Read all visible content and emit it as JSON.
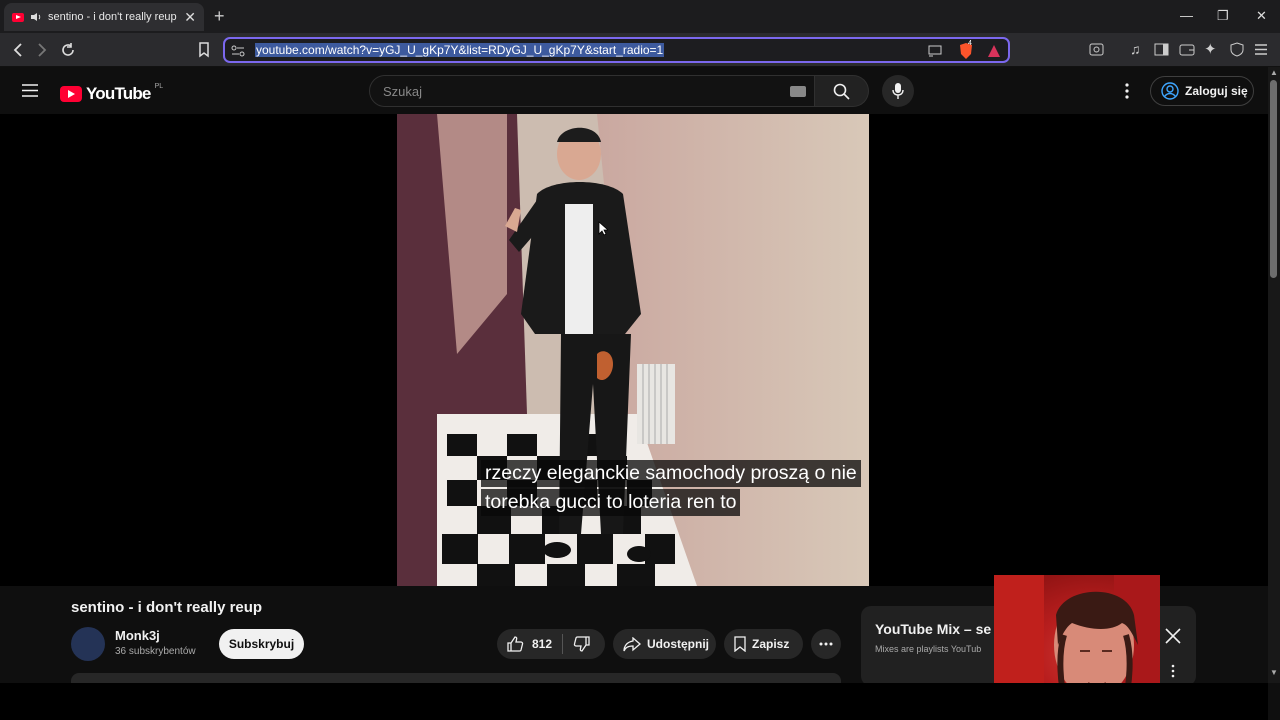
{
  "browser": {
    "tab_title": "sentino - i don't really reup -",
    "url": "youtube.com/watch?v=yGJ_U_gKp7Y&list=RDyGJ_U_gKp7Y&start_radio=1",
    "brave_badge": "4"
  },
  "header": {
    "logo_text": "YouTube",
    "country_code": "PL",
    "search_placeholder": "Szukaj",
    "sign_in_label": "Zaloguj się"
  },
  "player": {
    "subtitle_line_1": "rzeczy eleganckie samochody proszą o nie",
    "subtitle_line_2": "torebka gucci to loteria ren to"
  },
  "video": {
    "title": "sentino - i don't really reup",
    "channel_name": "Monk3j",
    "subscriber_count": "36 subskrybentów",
    "subscribe_label": "Subskrybuj",
    "like_count": "812",
    "share_label": "Udostępnij",
    "save_label": "Zapisz"
  },
  "mix": {
    "title": "YouTube Mix – se",
    "subtitle": "Mixes are playlists YouTub"
  },
  "colors": {
    "accent_brand": "#ff0033",
    "url_focus_border": "#7b68ee",
    "background": "#0f0f0f"
  }
}
